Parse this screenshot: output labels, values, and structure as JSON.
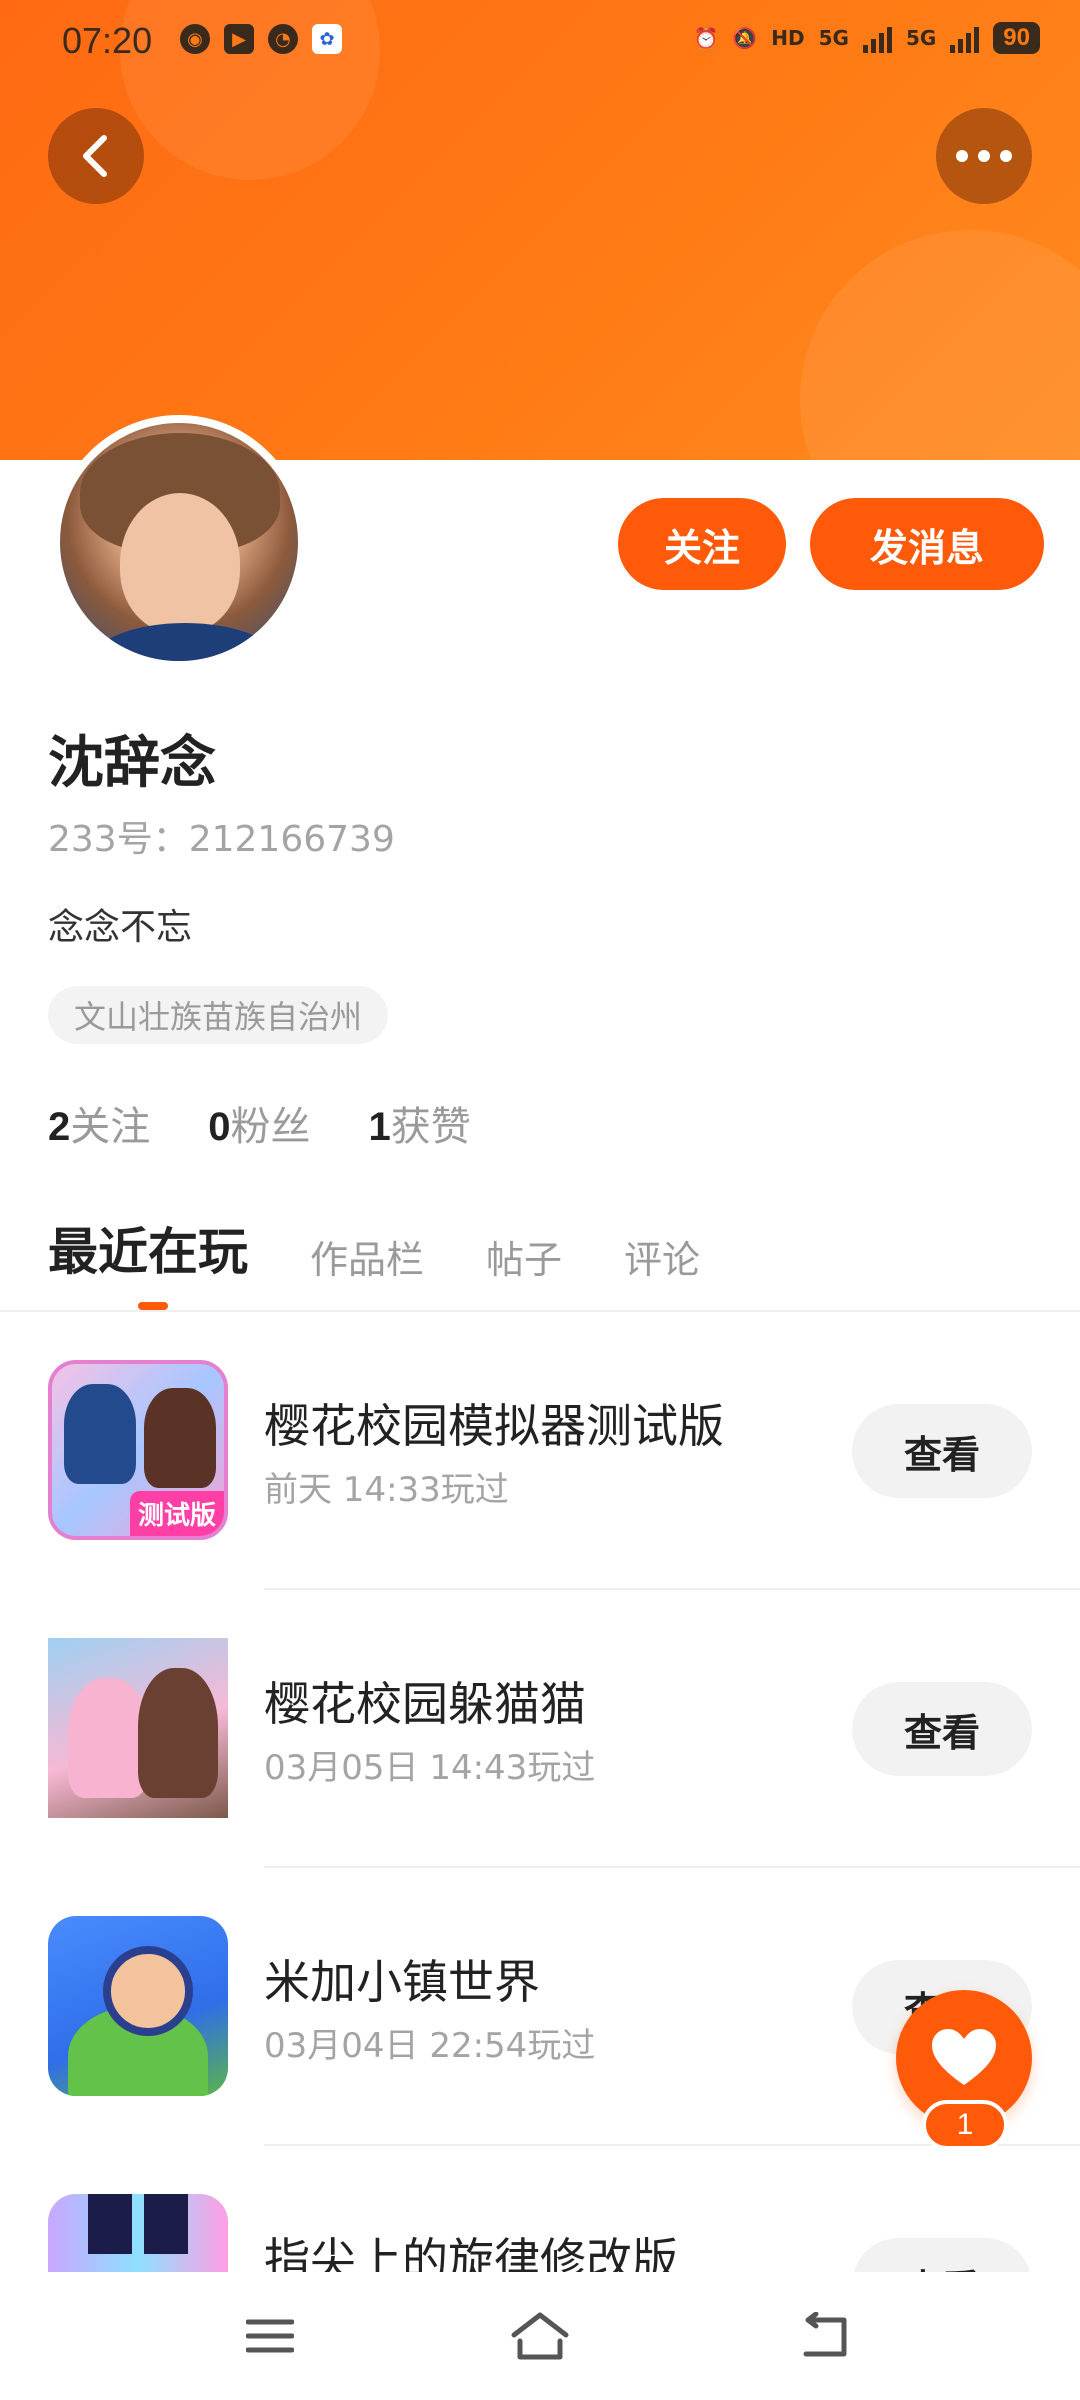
{
  "status_bar": {
    "time": "07:20",
    "battery": "90",
    "network_1": "5G",
    "network_2": "5G",
    "hd_label": "HD",
    "icons": [
      "hotspot-icon",
      "video-app-icon",
      "speed-icon",
      "baidu-icon",
      "alarm-icon",
      "mute-icon"
    ]
  },
  "header": {
    "back_icon": "chevron-left-icon",
    "more_icon": "more-icon",
    "colors": {
      "gradient_start": "#ff6a13",
      "gradient_end": "#ff8a1f"
    }
  },
  "profile": {
    "name": "沈辞念",
    "uid": "233号：212166739",
    "bio": "念念不忘",
    "location": "文山壮族苗族自治州",
    "follow_label": "关注",
    "message_label": "发消息",
    "accent_color": "#ff5a0a"
  },
  "stats": [
    {
      "num": "2",
      "label": "关注"
    },
    {
      "num": "0",
      "label": "粉丝"
    },
    {
      "num": "1",
      "label": "获赞"
    }
  ],
  "tabs": [
    {
      "label": "最近在玩",
      "active": true
    },
    {
      "label": "作品栏",
      "active": false
    },
    {
      "label": "帖子",
      "active": false
    },
    {
      "label": "评论",
      "active": false
    }
  ],
  "games": [
    {
      "title": "樱花校园模拟器测试版",
      "time": "前天 14:33玩过",
      "button": "查看",
      "icon_badge": "测试版"
    },
    {
      "title": "樱花校园躲猫猫",
      "time": "03月05日 14:43玩过",
      "button": "查看"
    },
    {
      "title": "米加小镇世界",
      "time": "03月04日 22:54玩过",
      "button": "查看"
    },
    {
      "title": "指尖上的旋律修改版",
      "time": "",
      "button": "查看"
    }
  ],
  "fab": {
    "icon": "heart-icon",
    "count": "1"
  },
  "nav": {
    "menu_icon": "menu-icon",
    "home_icon": "home-icon",
    "back_icon": "back-icon"
  }
}
